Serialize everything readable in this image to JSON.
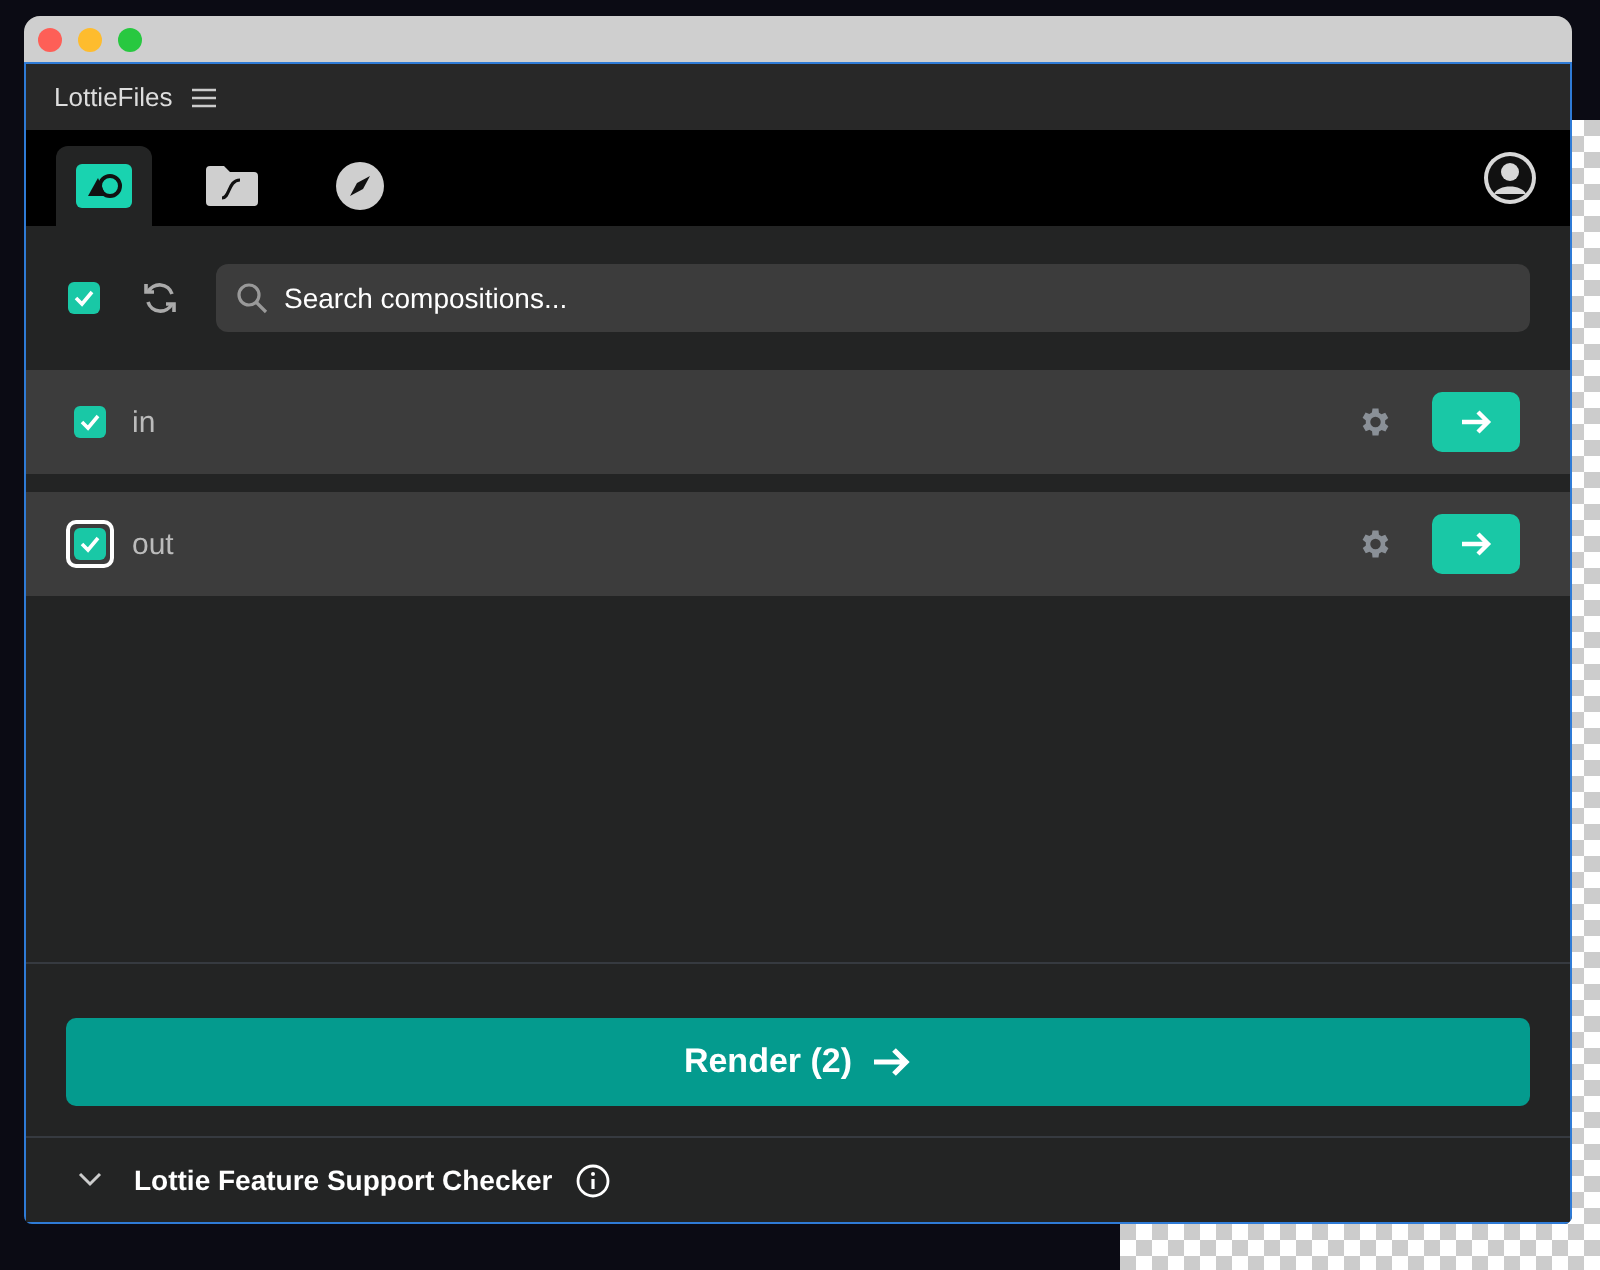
{
  "panel": {
    "title": "LottieFiles"
  },
  "tabs": [
    {
      "kind": "compositions",
      "selected": true
    },
    {
      "kind": "files",
      "selected": false
    },
    {
      "kind": "discover",
      "selected": false
    }
  ],
  "toolbar": {
    "select_all_checked": true,
    "search": {
      "placeholder": "Search compositions..."
    }
  },
  "compositions": [
    {
      "name": "in",
      "checked": true,
      "focused": false
    },
    {
      "name": "out",
      "checked": true,
      "focused": true
    }
  ],
  "render_button": {
    "label": "Render (2)"
  },
  "footer": {
    "label": "Lottie Feature Support Checker",
    "expanded": false
  }
}
